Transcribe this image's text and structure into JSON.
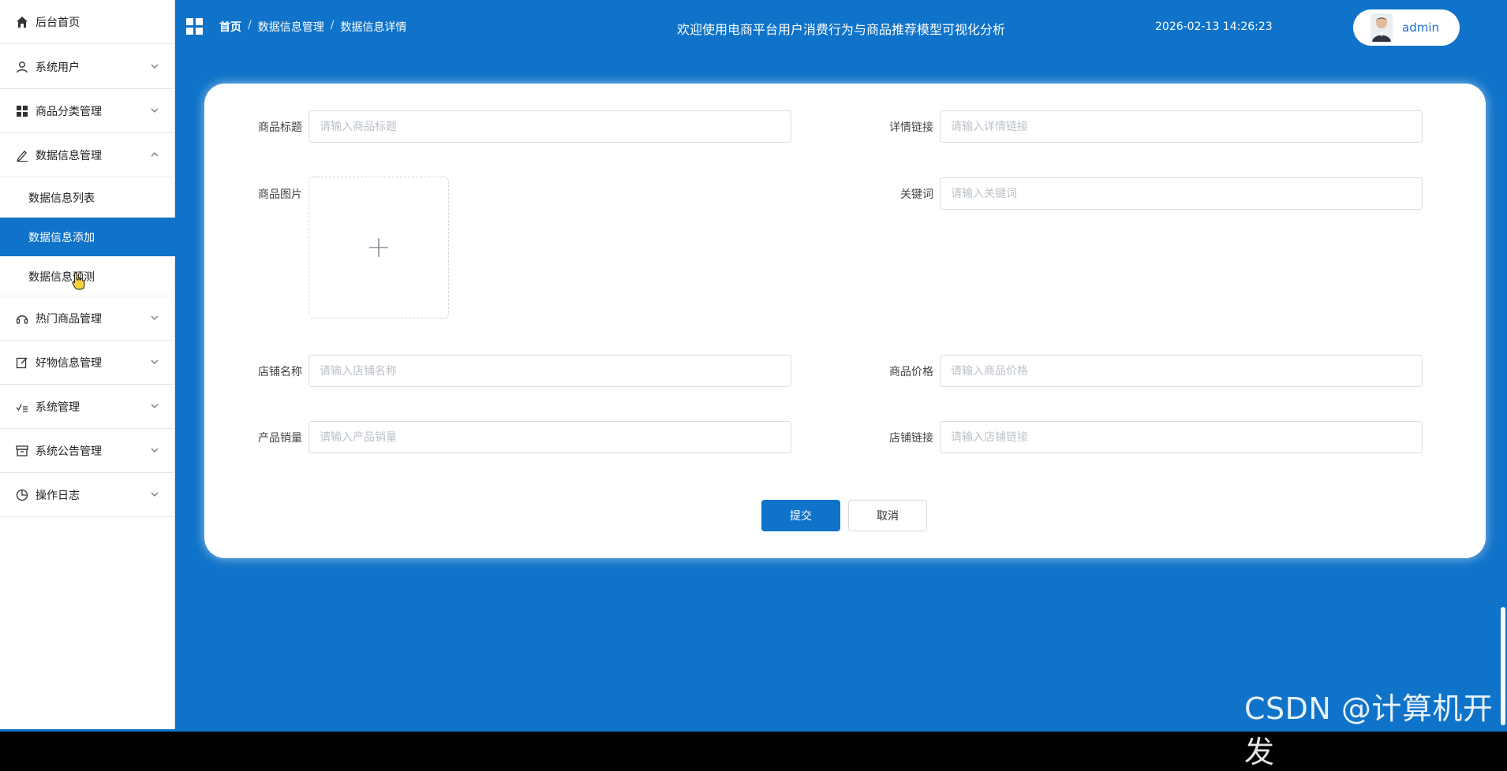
{
  "sidebar": {
    "items": [
      {
        "label": "后台首页"
      },
      {
        "label": "系统用户"
      },
      {
        "label": "商品分类管理"
      },
      {
        "label": "数据信息管理"
      },
      {
        "label": "热门商品管理"
      },
      {
        "label": "好物信息管理"
      },
      {
        "label": "系统管理"
      },
      {
        "label": "系统公告管理"
      },
      {
        "label": "操作日志"
      }
    ],
    "sub_items": [
      {
        "label": "数据信息列表"
      },
      {
        "label": "数据信息添加"
      },
      {
        "label": "数据信息预测"
      }
    ]
  },
  "header": {
    "breadcrumb": [
      "首页",
      "数据信息管理",
      "数据信息详情"
    ],
    "breadcrumb_sep": "/",
    "title": "欢迎使用电商平台用户消费行为与商品推荐模型可视化分析",
    "datetime": "2026-02-13 14:26:23",
    "user": "admin"
  },
  "form": {
    "fields": [
      {
        "label": "商品标题",
        "placeholder": "请输入商品标题",
        "value": ""
      },
      {
        "label": "详情链接",
        "placeholder": "请输入详情链接",
        "value": ""
      },
      {
        "label": "商品图片"
      },
      {
        "label": "关键词",
        "placeholder": "请输入关键词",
        "value": ""
      },
      {
        "label": "店铺名称",
        "placeholder": "请输入店铺名称",
        "value": ""
      },
      {
        "label": "商品价格",
        "placeholder": "请输入商品价格",
        "value": ""
      },
      {
        "label": "产品销量",
        "placeholder": "请输入产品销量",
        "value": ""
      },
      {
        "label": "店铺链接",
        "placeholder": "请输入店铺链接",
        "value": ""
      }
    ],
    "submit_label": "提交",
    "cancel_label": "取消"
  },
  "watermark": "CSDN @计算机开发",
  "colors": {
    "primary": "#0f73c9",
    "sidebar_bg": "#ffffff",
    "card_bg": "#ffffff"
  }
}
